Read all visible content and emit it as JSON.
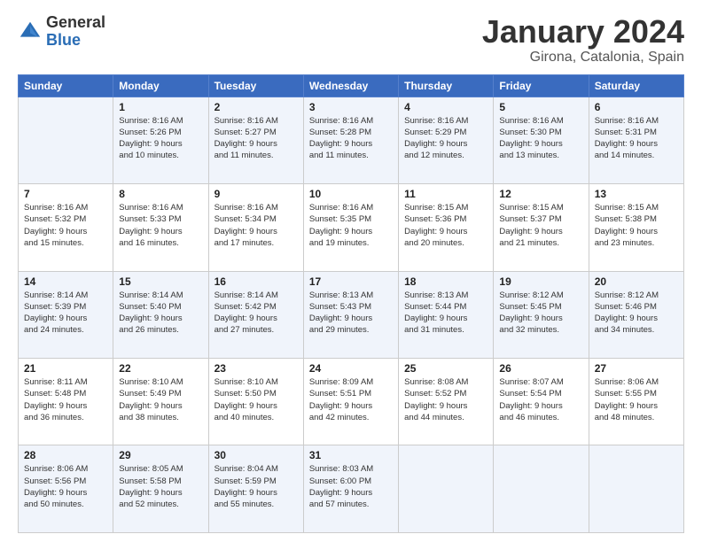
{
  "header": {
    "logo_general": "General",
    "logo_blue": "Blue",
    "month_title": "January 2024",
    "subtitle": "Girona, Catalonia, Spain"
  },
  "weekdays": [
    "Sunday",
    "Monday",
    "Tuesday",
    "Wednesday",
    "Thursday",
    "Friday",
    "Saturday"
  ],
  "weeks": [
    [
      {
        "day": "",
        "info": ""
      },
      {
        "day": "1",
        "info": "Sunrise: 8:16 AM\nSunset: 5:26 PM\nDaylight: 9 hours\nand 10 minutes."
      },
      {
        "day": "2",
        "info": "Sunrise: 8:16 AM\nSunset: 5:27 PM\nDaylight: 9 hours\nand 11 minutes."
      },
      {
        "day": "3",
        "info": "Sunrise: 8:16 AM\nSunset: 5:28 PM\nDaylight: 9 hours\nand 11 minutes."
      },
      {
        "day": "4",
        "info": "Sunrise: 8:16 AM\nSunset: 5:29 PM\nDaylight: 9 hours\nand 12 minutes."
      },
      {
        "day": "5",
        "info": "Sunrise: 8:16 AM\nSunset: 5:30 PM\nDaylight: 9 hours\nand 13 minutes."
      },
      {
        "day": "6",
        "info": "Sunrise: 8:16 AM\nSunset: 5:31 PM\nDaylight: 9 hours\nand 14 minutes."
      }
    ],
    [
      {
        "day": "7",
        "info": "Sunrise: 8:16 AM\nSunset: 5:32 PM\nDaylight: 9 hours\nand 15 minutes."
      },
      {
        "day": "8",
        "info": "Sunrise: 8:16 AM\nSunset: 5:33 PM\nDaylight: 9 hours\nand 16 minutes."
      },
      {
        "day": "9",
        "info": "Sunrise: 8:16 AM\nSunset: 5:34 PM\nDaylight: 9 hours\nand 17 minutes."
      },
      {
        "day": "10",
        "info": "Sunrise: 8:16 AM\nSunset: 5:35 PM\nDaylight: 9 hours\nand 19 minutes."
      },
      {
        "day": "11",
        "info": "Sunrise: 8:15 AM\nSunset: 5:36 PM\nDaylight: 9 hours\nand 20 minutes."
      },
      {
        "day": "12",
        "info": "Sunrise: 8:15 AM\nSunset: 5:37 PM\nDaylight: 9 hours\nand 21 minutes."
      },
      {
        "day": "13",
        "info": "Sunrise: 8:15 AM\nSunset: 5:38 PM\nDaylight: 9 hours\nand 23 minutes."
      }
    ],
    [
      {
        "day": "14",
        "info": "Sunrise: 8:14 AM\nSunset: 5:39 PM\nDaylight: 9 hours\nand 24 minutes."
      },
      {
        "day": "15",
        "info": "Sunrise: 8:14 AM\nSunset: 5:40 PM\nDaylight: 9 hours\nand 26 minutes."
      },
      {
        "day": "16",
        "info": "Sunrise: 8:14 AM\nSunset: 5:42 PM\nDaylight: 9 hours\nand 27 minutes."
      },
      {
        "day": "17",
        "info": "Sunrise: 8:13 AM\nSunset: 5:43 PM\nDaylight: 9 hours\nand 29 minutes."
      },
      {
        "day": "18",
        "info": "Sunrise: 8:13 AM\nSunset: 5:44 PM\nDaylight: 9 hours\nand 31 minutes."
      },
      {
        "day": "19",
        "info": "Sunrise: 8:12 AM\nSunset: 5:45 PM\nDaylight: 9 hours\nand 32 minutes."
      },
      {
        "day": "20",
        "info": "Sunrise: 8:12 AM\nSunset: 5:46 PM\nDaylight: 9 hours\nand 34 minutes."
      }
    ],
    [
      {
        "day": "21",
        "info": "Sunrise: 8:11 AM\nSunset: 5:48 PM\nDaylight: 9 hours\nand 36 minutes."
      },
      {
        "day": "22",
        "info": "Sunrise: 8:10 AM\nSunset: 5:49 PM\nDaylight: 9 hours\nand 38 minutes."
      },
      {
        "day": "23",
        "info": "Sunrise: 8:10 AM\nSunset: 5:50 PM\nDaylight: 9 hours\nand 40 minutes."
      },
      {
        "day": "24",
        "info": "Sunrise: 8:09 AM\nSunset: 5:51 PM\nDaylight: 9 hours\nand 42 minutes."
      },
      {
        "day": "25",
        "info": "Sunrise: 8:08 AM\nSunset: 5:52 PM\nDaylight: 9 hours\nand 44 minutes."
      },
      {
        "day": "26",
        "info": "Sunrise: 8:07 AM\nSunset: 5:54 PM\nDaylight: 9 hours\nand 46 minutes."
      },
      {
        "day": "27",
        "info": "Sunrise: 8:06 AM\nSunset: 5:55 PM\nDaylight: 9 hours\nand 48 minutes."
      }
    ],
    [
      {
        "day": "28",
        "info": "Sunrise: 8:06 AM\nSunset: 5:56 PM\nDaylight: 9 hours\nand 50 minutes."
      },
      {
        "day": "29",
        "info": "Sunrise: 8:05 AM\nSunset: 5:58 PM\nDaylight: 9 hours\nand 52 minutes."
      },
      {
        "day": "30",
        "info": "Sunrise: 8:04 AM\nSunset: 5:59 PM\nDaylight: 9 hours\nand 55 minutes."
      },
      {
        "day": "31",
        "info": "Sunrise: 8:03 AM\nSunset: 6:00 PM\nDaylight: 9 hours\nand 57 minutes."
      },
      {
        "day": "",
        "info": ""
      },
      {
        "day": "",
        "info": ""
      },
      {
        "day": "",
        "info": ""
      }
    ]
  ]
}
